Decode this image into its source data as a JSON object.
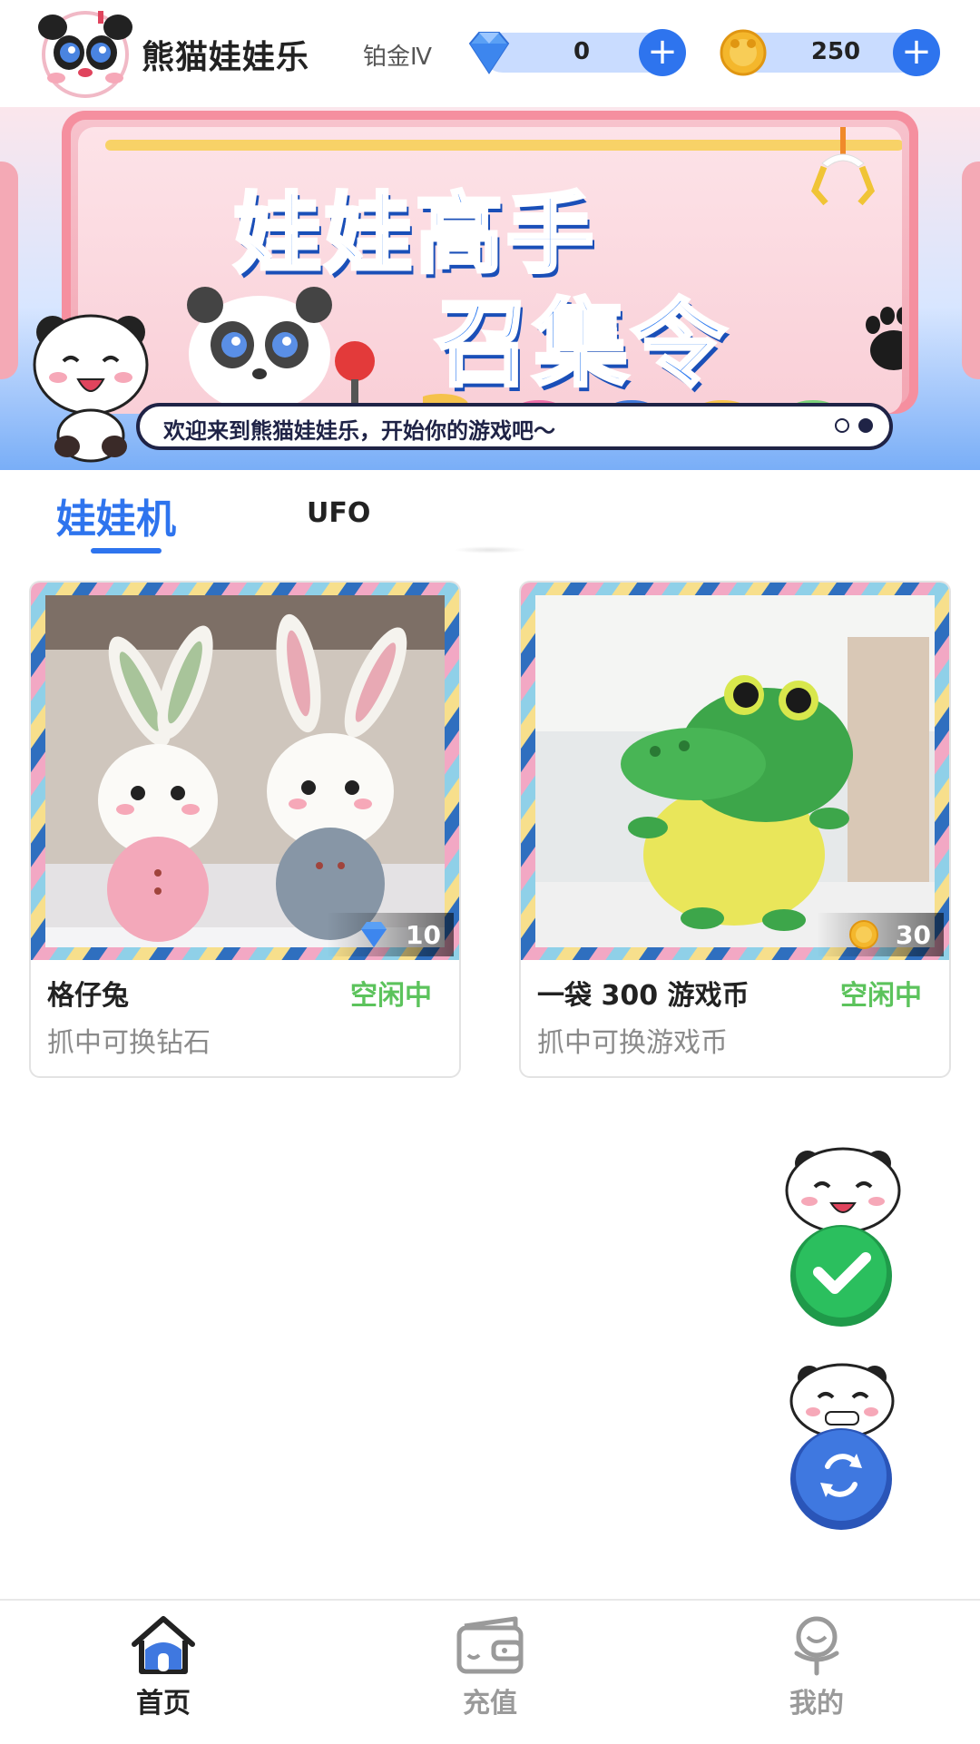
{
  "header": {
    "app_name": "熊猫娃娃乐",
    "rank": "铂金Ⅳ",
    "diamond_balance": "0",
    "coin_balance": "250"
  },
  "banner": {
    "headline_line1": "娃娃高手",
    "headline_line2": "召集令",
    "marquee": "欢迎来到熊猫娃娃乐，开始你的游戏吧～",
    "page_count": 2,
    "active_page": 2
  },
  "tabs": [
    {
      "label": "娃娃机",
      "active": true
    },
    {
      "label": "UFO",
      "active": false
    }
  ],
  "machines": [
    {
      "name": "格仔兔",
      "status": "空闲中",
      "description": "抓中可换钻石",
      "price": "10",
      "price_currency_icon": "diamond-icon"
    },
    {
      "name": "一袋 300 游戏币",
      "status": "空闲中",
      "description": "抓中可换游戏币",
      "price": "30",
      "price_currency_icon": "coin-icon"
    }
  ],
  "bottom_nav": [
    {
      "label": "首页",
      "icon": "home-icon",
      "active": true
    },
    {
      "label": "充值",
      "icon": "wallet-icon",
      "active": false
    },
    {
      "label": "我的",
      "icon": "profile-icon",
      "active": false
    }
  ],
  "colors": {
    "accent": "#2e74ee",
    "status_idle": "#5cc35c",
    "balance_pill": "#c9dcff",
    "checkin_green": "#2bbf5e"
  }
}
